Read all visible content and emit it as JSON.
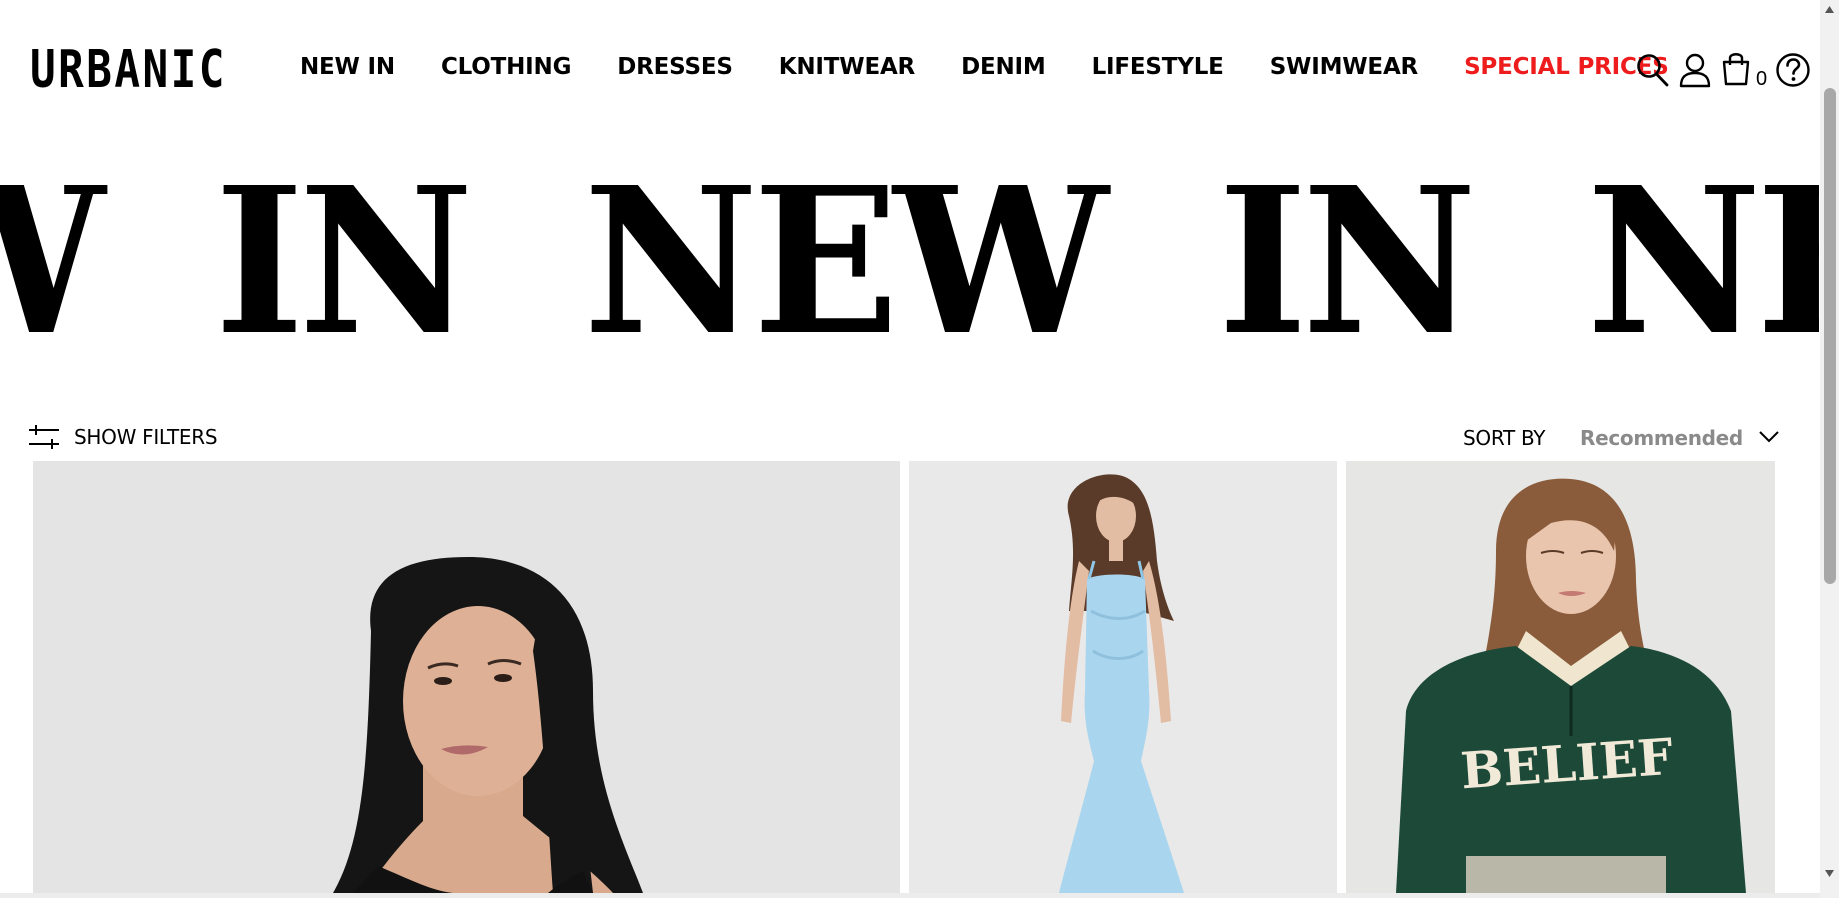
{
  "brand": {
    "logo_text": "URBANIC"
  },
  "nav": {
    "items": [
      {
        "label": "NEW IN"
      },
      {
        "label": "CLOTHING"
      },
      {
        "label": "DRESSES"
      },
      {
        "label": "KNITWEAR"
      },
      {
        "label": "DENIM"
      },
      {
        "label": "LIFESTYLE"
      },
      {
        "label": "SWIMWEAR"
      },
      {
        "label": "SPECIAL PRICES",
        "color": "#ee1c1c"
      }
    ]
  },
  "header_icons": {
    "search": "search-icon",
    "account": "user-icon",
    "cart": "shopping-bag-icon",
    "cart_count": "0",
    "help": "help-icon"
  },
  "banner": {
    "words": [
      "W",
      "IN",
      "NEW",
      "IN",
      "NEW",
      "I"
    ]
  },
  "toolbar": {
    "filters_label": "SHOW FILTERS",
    "sort_label": "SORT BY",
    "sort_value": "Recommended"
  },
  "products": [
    {
      "alt": "Model with long dark hair wearing black top",
      "image_text": ""
    },
    {
      "alt": "Model in light blue strappy maxi dress",
      "image_text": ""
    },
    {
      "alt": "Model in dark green half-zip sweatshirt",
      "image_text": "BELIEF"
    }
  ],
  "colors": {
    "accent_red": "#ee1c1c",
    "sort_value_gray": "#8a8a8a",
    "product_bg": "#e6e6e6"
  }
}
